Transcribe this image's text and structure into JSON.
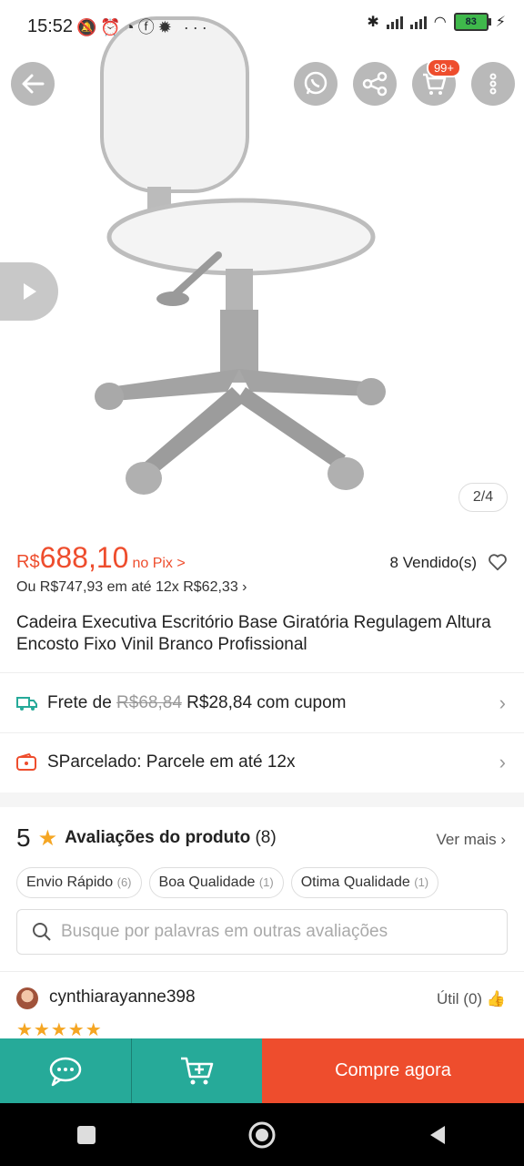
{
  "status_bar": {
    "time": "15:52",
    "left_icons": "bell-off alarm whatsapp facebook settings more",
    "battery": "83"
  },
  "gallery": {
    "pager": "2/4",
    "cart_badge": "99+"
  },
  "price": {
    "currency": "R$",
    "value": "688,10",
    "pix_label": "no Pix >",
    "sold": "8 Vendido(s)",
    "installment": "Ou R$747,93 em até 12x R$62,33 ›"
  },
  "product": {
    "title": "Cadeira Executiva Escritório Base Giratória Regulagem Altura Encosto Fixo Vinil Branco Profissional"
  },
  "shipping": {
    "prefix": "Frete de",
    "old": "R$68,84",
    "new": "R$28,84 com cupom"
  },
  "installments": {
    "label": "SParcelado: Parcele em até 12x"
  },
  "reviews": {
    "score": "5",
    "label": "Avaliações do produto",
    "count": "(8)",
    "see_more": "Ver mais ›",
    "chips": [
      {
        "label": "Envio Rápido",
        "count": "(6)"
      },
      {
        "label": "Boa Qualidade",
        "count": "(1)"
      },
      {
        "label": "Otima Qualidade",
        "count": "(1)"
      }
    ],
    "search_placeholder": "Busque por palavras em outras avaliações",
    "first": {
      "user": "cynthiarayanne398",
      "useful": "Útil (0)",
      "stars": "★★★★★"
    }
  },
  "bottom_bar": {
    "buy_label": "Compre agora"
  },
  "colors": {
    "accent": "#ee4d2d",
    "teal": "#26aa99",
    "star": "#f5a623"
  }
}
